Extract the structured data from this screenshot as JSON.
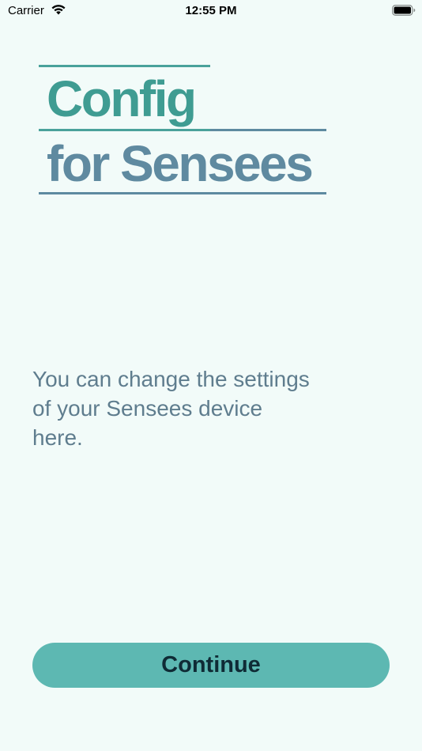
{
  "status_bar": {
    "carrier": "Carrier",
    "time": "12:55 PM",
    "wifi_icon": "wifi-icon",
    "battery_icon": "battery-icon"
  },
  "logo": {
    "line1": "Config",
    "line2": "for Sensees",
    "colors": {
      "primary": "#3f9c92",
      "secondary": "#5f8aa0"
    }
  },
  "description": "You can change the settings of your Sensees device here.",
  "continue_button": {
    "label": "Continue",
    "color": "#5db8b2"
  },
  "background_color": "#f2fbf9"
}
